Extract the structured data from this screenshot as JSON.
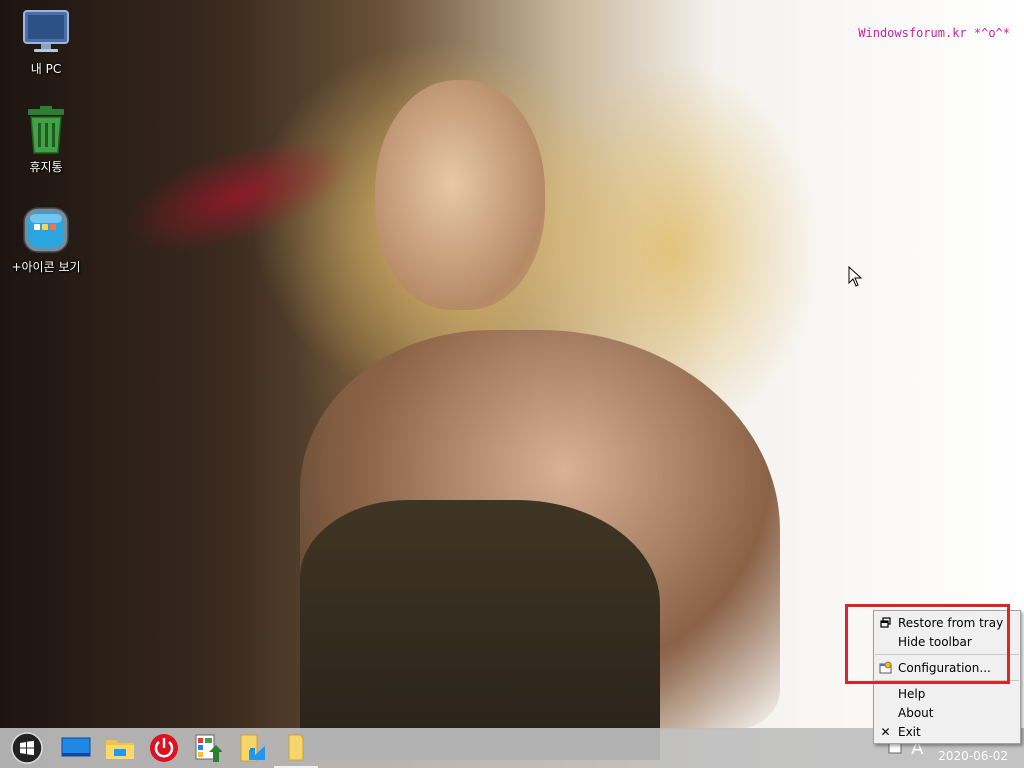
{
  "desktop_icons": [
    {
      "label": "내 PC",
      "icon": "monitor-icon"
    },
    {
      "label": "휴지통",
      "icon": "recycle-bin-icon"
    },
    {
      "label": "+아이콘 보기",
      "icon": "show-icons-icon"
    }
  ],
  "watermark": "Windowsforum.kr  *^o^*",
  "taskbar": {
    "start_icon": "windows-logo-icon",
    "pinned": [
      {
        "name": "desktop-icon"
      },
      {
        "name": "file-explorer-icon"
      },
      {
        "name": "power-icon"
      },
      {
        "name": "app-manager-icon"
      },
      {
        "name": "folder-shortcut-icon"
      },
      {
        "name": "folder-icon"
      }
    ],
    "tray_glyph": "A",
    "clock": "2020-06-02"
  },
  "context_menu": {
    "items": [
      {
        "label": "Restore from tray",
        "icon": "restore-window-icon"
      },
      {
        "label": "Hide toolbar"
      },
      {
        "separator": true
      },
      {
        "label": "Configuration...",
        "icon": "config-icon"
      },
      {
        "separator": true
      },
      {
        "label": "Help"
      },
      {
        "label": "About"
      },
      {
        "label": "Exit",
        "icon": "close-icon"
      }
    ]
  },
  "colors": {
    "watermark": "#d21ea0",
    "highlight": "#e0232b",
    "taskbar": "#bebebe",
    "power_red": "#e01020"
  }
}
